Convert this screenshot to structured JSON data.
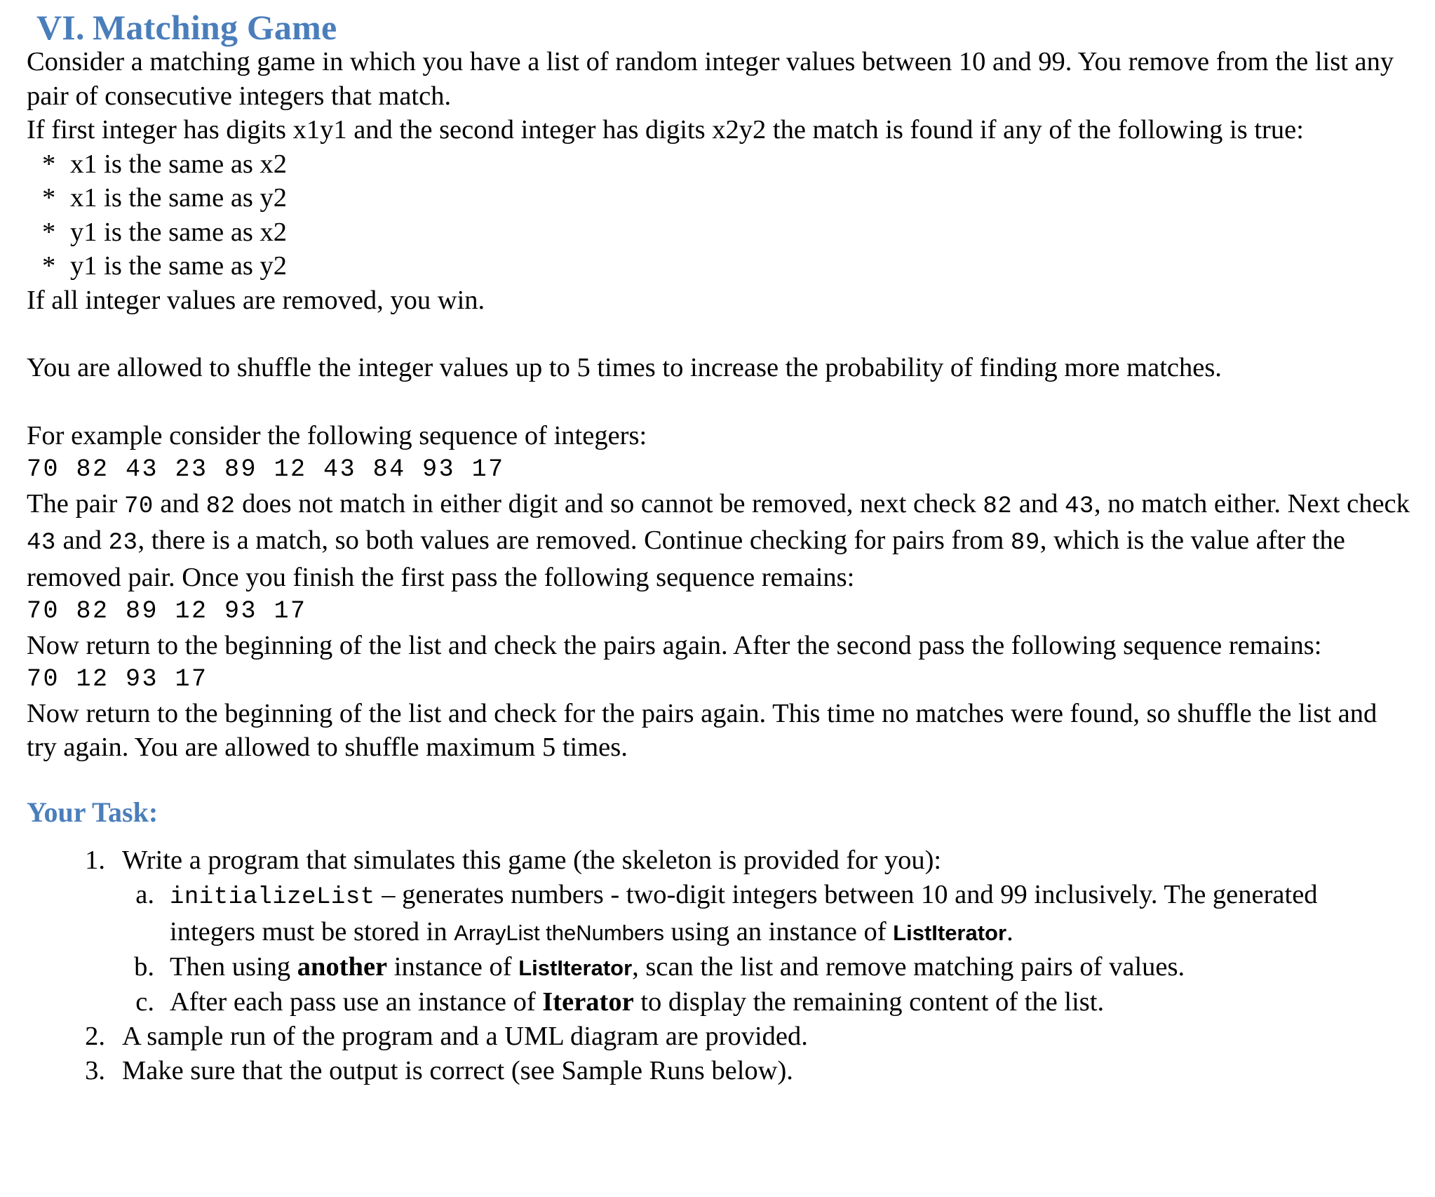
{
  "heading": {
    "numeral": "VI.",
    "title": "Matching Game"
  },
  "intro": {
    "p1": "Consider a matching game in which you have a list of random integer values between 10 and 99. You remove from the list any pair of consecutive integers that match.",
    "p2": "If first integer has digits x1y1 and the second integer has digits x2y2 the match is found if any of the following is true:"
  },
  "match_rules": {
    "marker": "*",
    "items": [
      "x1 is the same as x2",
      "x1 is the same as y2",
      "y1 is the same as x2",
      "y1 is the same as y2"
    ]
  },
  "win_line": "If all integer values are removed, you win.",
  "shuffle_line": "You are allowed to shuffle the integer values up to 5 times to increase the probability of finding more matches.",
  "example": {
    "lead_in": "For example consider the following sequence of integers:",
    "sequence_1": "70 82 43 23 89 12 43 84 93 17",
    "walkthrough_1_a": "The pair ",
    "walkthrough_1_n1": "70",
    "walkthrough_1_b": " and ",
    "walkthrough_1_n2": "82",
    "walkthrough_1_c": " does not match in either digit and so cannot be removed, next check ",
    "walkthrough_1_n3": "82",
    "walkthrough_1_d": " and ",
    "walkthrough_1_n4": "43",
    "walkthrough_1_e": ", no match either. Next check ",
    "walkthrough_1_n5": "43",
    "walkthrough_1_f": " and ",
    "walkthrough_1_n6": "23",
    "walkthrough_1_g": ", there is a match, so both values are removed. Continue checking for pairs from ",
    "walkthrough_1_n7": "89",
    "walkthrough_1_h": ", which is the value after the removed pair. Once you finish the first pass the following sequence remains:",
    "sequence_2": "70 82 89 12 93 17",
    "pass_2_text": "Now return to the beginning of the list and check the pairs again. After the second pass the following sequence remains:",
    "sequence_3": "70 12 93 17",
    "pass_3_text": "Now return to the beginning of the list and check for the pairs again. This time no matches were found, so shuffle the list and try again. You are allowed to shuffle maximum 5 times."
  },
  "your_task": {
    "heading": "Your Task:",
    "items": [
      {
        "number": "1.",
        "text": "Write a program that simulates this game (the skeleton is provided for you):",
        "subitems": [
          {
            "letter": "a.",
            "code": "initializeList",
            "text_1": " – generates numbers - two-digit integers between 10 and 99 inclusively. The generated integers must be stored in ",
            "sans_1": "ArrayList theNumbers",
            "text_2": " using an instance of ",
            "sans_bold_1": "ListIterator",
            "text_3": "."
          },
          {
            "letter": "b.",
            "text_1": "Then using ",
            "bold_1": "another",
            "text_2": " instance of ",
            "sans_bold_1": "ListIterator",
            "text_3": ", scan the list and remove matching pairs of values."
          },
          {
            "letter": "c.",
            "text_1": "After each pass use an instance of ",
            "bold_1": "Iterator",
            "text_2": " to display the remaining content of the list."
          }
        ]
      },
      {
        "number": "2.",
        "text": "A sample run of the program and a UML diagram are provided.",
        "subitems": []
      },
      {
        "number": "3.",
        "text": "Make sure that the output is correct (see Sample Runs below).",
        "subitems": []
      }
    ]
  },
  "colors": {
    "heading_blue": "#4a7ebb",
    "body_text": "#000000",
    "page_background": "#ffffff"
  }
}
